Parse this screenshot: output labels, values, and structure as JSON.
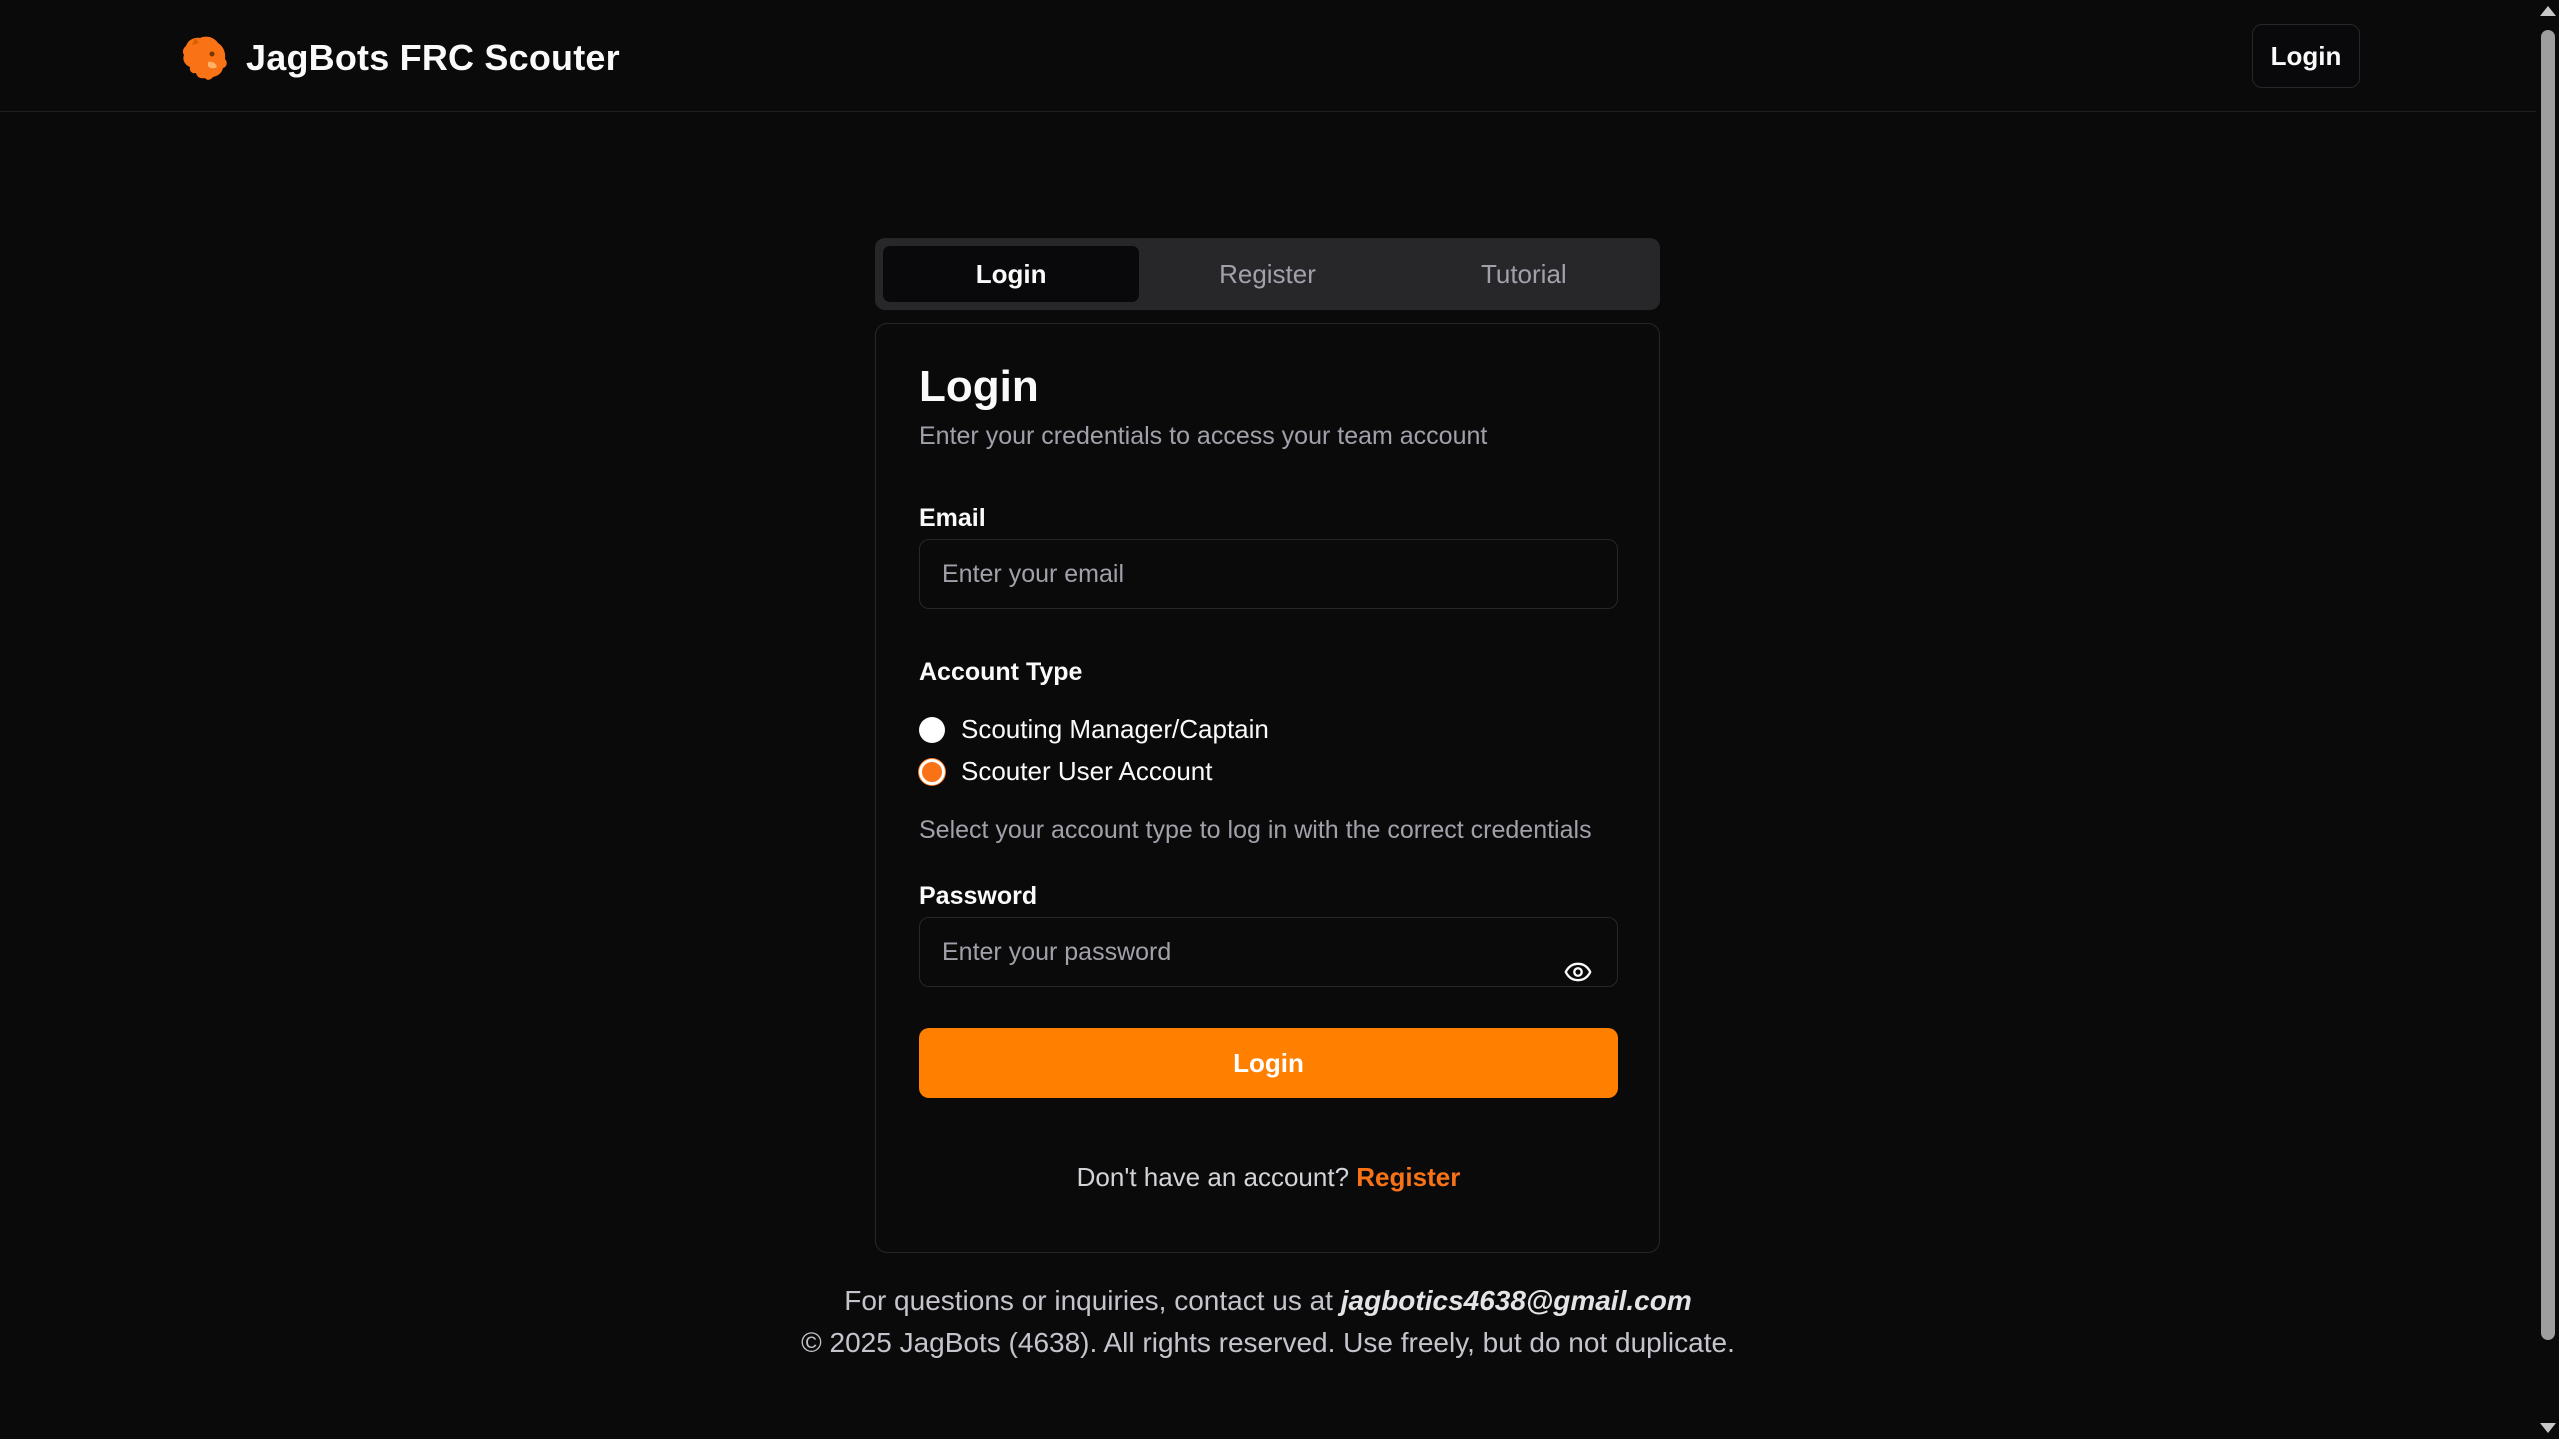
{
  "app": {
    "title": "JagBots FRC Scouter",
    "logo_icon": "jaguar-head-icon",
    "header_login_label": "Login"
  },
  "tabs": [
    {
      "label": "Login",
      "active": true
    },
    {
      "label": "Register",
      "active": false
    },
    {
      "label": "Tutorial",
      "active": false
    }
  ],
  "form": {
    "title": "Login",
    "subtitle": "Enter your credentials to access your team account",
    "email_label": "Email",
    "email_placeholder": "Enter your email",
    "email_value": "",
    "account_type_label": "Account Type",
    "account_types": [
      {
        "label": "Scouting Manager/Captain",
        "selected": false
      },
      {
        "label": "Scouter User Account",
        "selected": true
      }
    ],
    "account_type_helper": "Select your account type to log in with the correct credentials",
    "password_label": "Password",
    "password_placeholder": "Enter your password",
    "password_value": "",
    "show_password_icon": "eye-icon",
    "submit_label": "Login",
    "no_account_text": "Don't have an account?",
    "register_link": "Register"
  },
  "footer": {
    "contact_text": "For questions or inquiries, contact us at",
    "contact_email": "jagbotics4638@gmail.com",
    "copyright": "© 2025 JagBots (4638). All rights reserved. Use freely, but do not duplicate."
  },
  "colors": {
    "accent": "#ff7f00",
    "background": "#0a0a0b",
    "border": "#27272a",
    "muted_text": "#a1a1aa"
  }
}
